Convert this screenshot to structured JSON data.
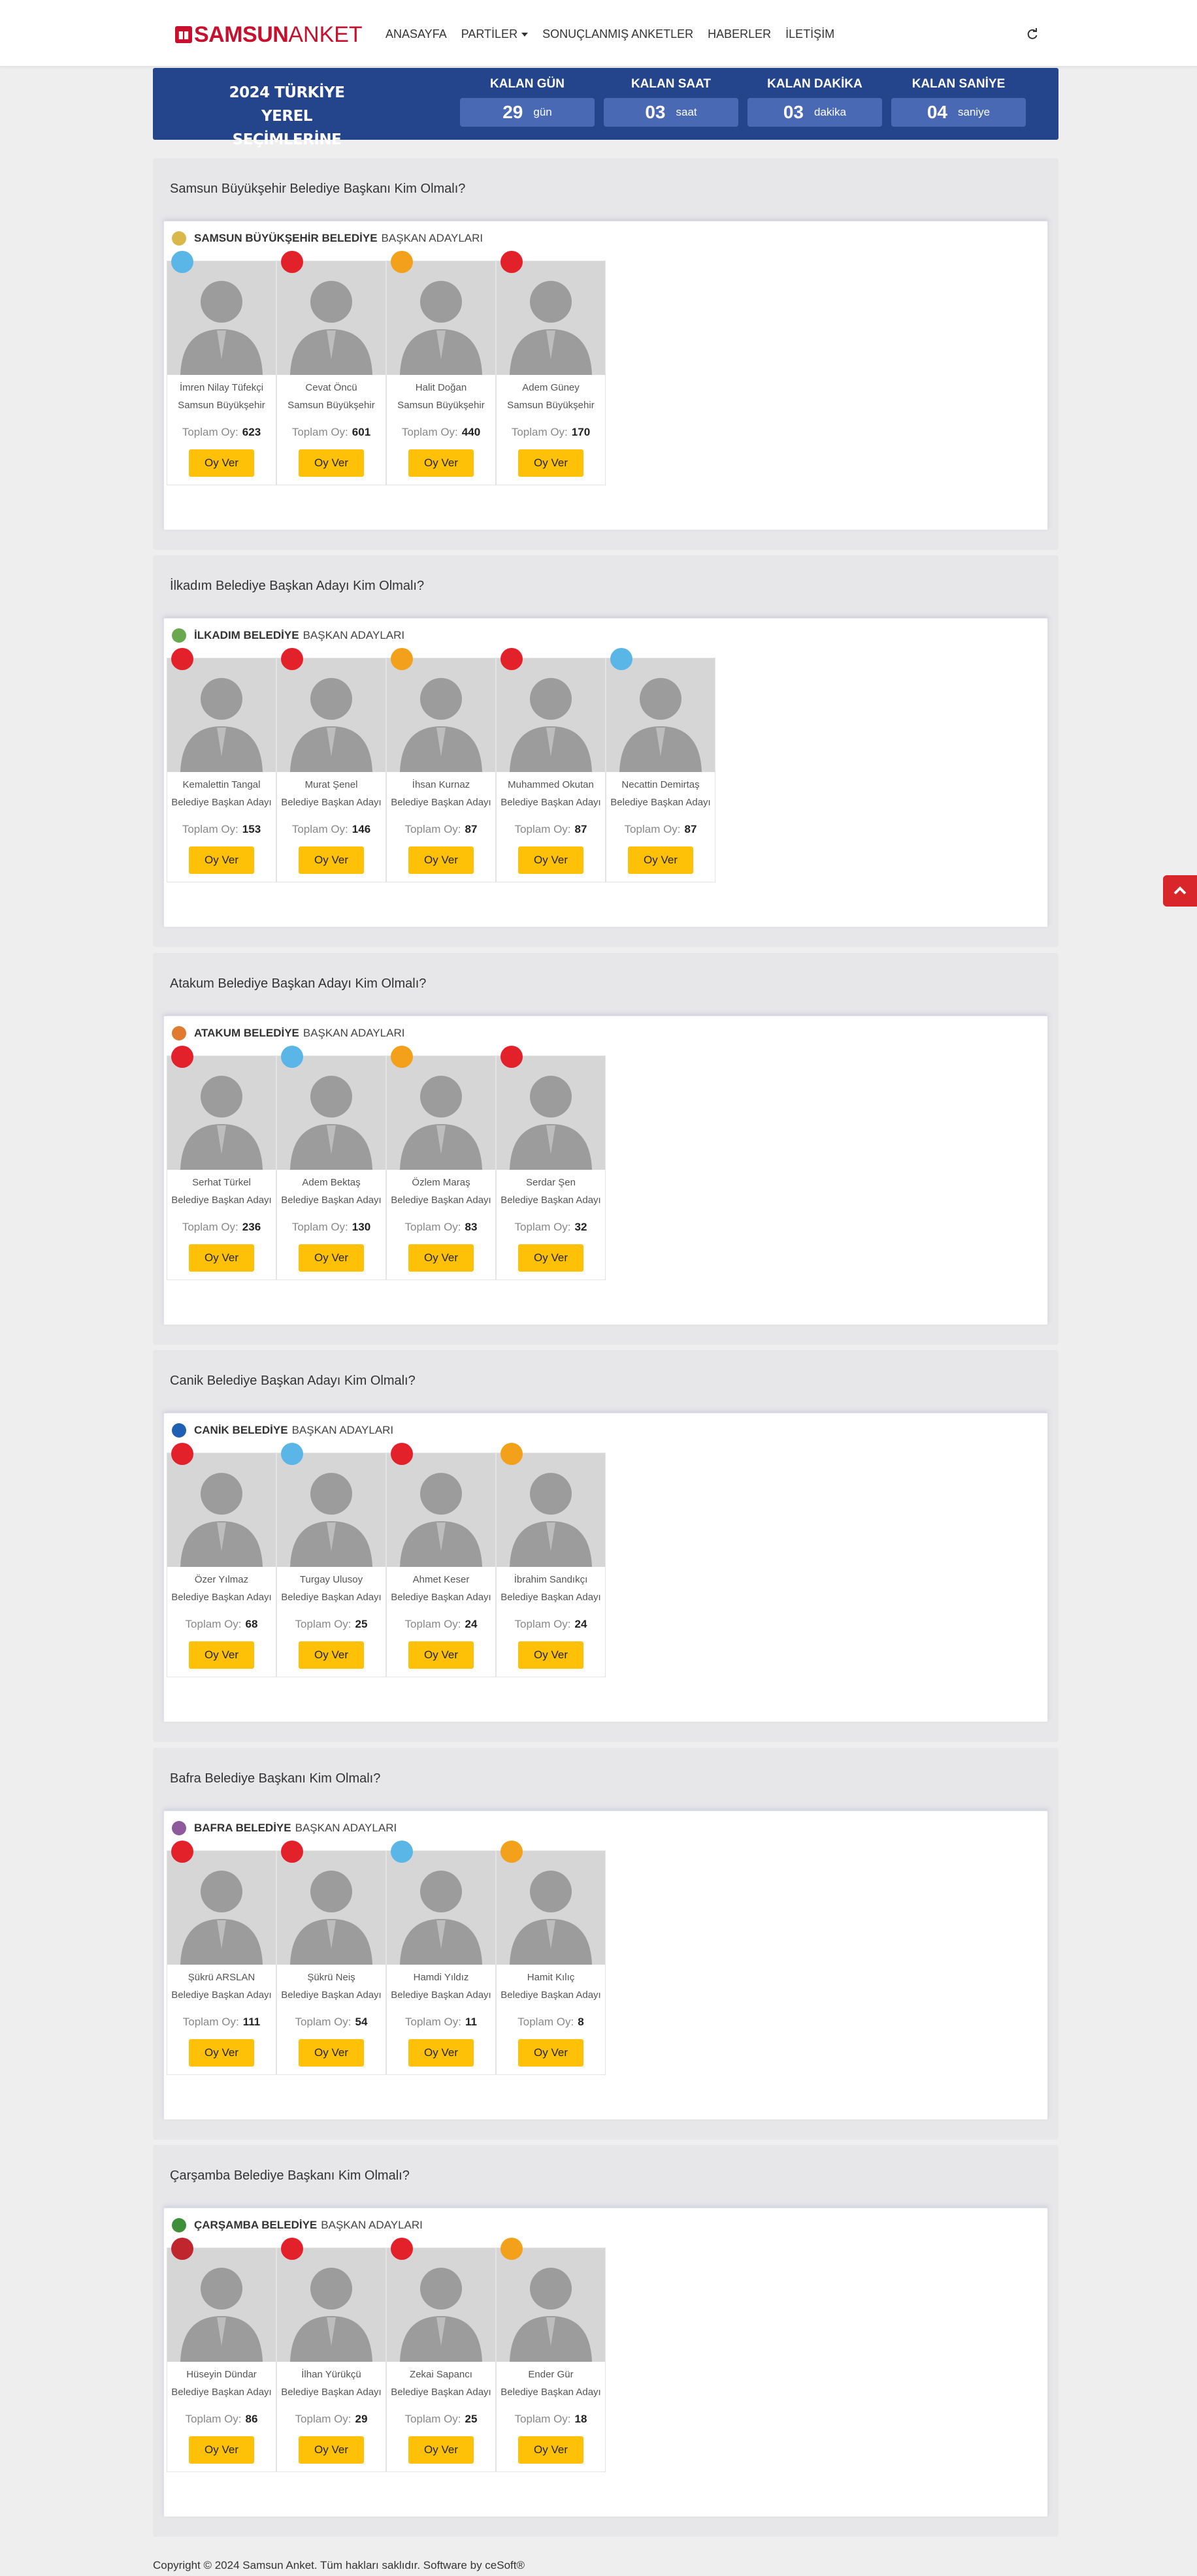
{
  "brand": {
    "part_a": "SAMSUN",
    "part_b": "ANKET"
  },
  "menu": [
    {
      "label": "ANASAYFA"
    },
    {
      "label": "PARTİLER"
    },
    {
      "label": "SONUÇLANMIŞ ANKETLER"
    },
    {
      "label": "HABERLER"
    },
    {
      "label": "İLETİŞİM"
    }
  ],
  "countdown": {
    "title_line1": "2024 TÜRKİYE",
    "title_line2": "YEREL SEÇİMLERİNE",
    "boxes": [
      {
        "label": "KALAN GÜN",
        "value": "29",
        "unit": "gün"
      },
      {
        "label": "KALAN SAAT",
        "value": "03",
        "unit": "saat"
      },
      {
        "label": "KALAN DAKİKA",
        "value": "03",
        "unit": "dakika"
      },
      {
        "label": "KALAN SANİYE",
        "value": "04",
        "unit": "saniye"
      }
    ]
  },
  "sections": [
    {
      "question": "Samsun Büyükşehir Belediye Başkanı Kim Olmalı?",
      "municipality": "SAMSUN BÜYÜKŞEHİR BELEDİYE",
      "suffix": "BAŞKAN ADAYLARI",
      "candidates": [
        {
          "name": "İmren Nilay Tüfekçi",
          "title": "Samsun Büyükşehir",
          "votes": "623",
          "button": "Oy Ver",
          "party_color": "#5ab6e6"
        },
        {
          "name": "Cevat Öncü",
          "title": "Samsun Büyükşehir",
          "votes": "601",
          "button": "Oy Ver",
          "party_color": "#e3212a"
        },
        {
          "name": "Halit Doğan",
          "title": "Samsun Büyükşehir",
          "votes": "440",
          "button": "Oy Ver",
          "party_color": "#f3a01b"
        },
        {
          "name": "Adem Güney",
          "title": "Samsun Büyükşehir",
          "votes": "170",
          "button": "Oy Ver",
          "party_color": "#e3212a"
        }
      ]
    },
    {
      "question": "İlkadım Belediye Başkan Adayı Kim Olmalı?",
      "municipality": "İLKADIM BELEDİYE",
      "suffix": "BAŞKAN ADAYLARI",
      "candidates": [
        {
          "name": "Kemalettin Tangal",
          "title": "Belediye Başkan Adayı",
          "votes": "153",
          "button": "Oy Ver",
          "party_color": "#e3212a"
        },
        {
          "name": "Murat Şenel",
          "title": "Belediye Başkan Adayı",
          "votes": "146",
          "button": "Oy Ver",
          "party_color": "#e3212a"
        },
        {
          "name": "İhsan Kurnaz",
          "title": "Belediye Başkan Adayı",
          "votes": "87",
          "button": "Oy Ver",
          "party_color": "#f3a01b"
        },
        {
          "name": "Muhammed Okutan",
          "title": "Belediye Başkan Adayı",
          "votes": "87",
          "button": "Oy Ver",
          "party_color": "#e3212a"
        },
        {
          "name": "Necattin Demirtaş",
          "title": "Belediye Başkan Adayı",
          "votes": "87",
          "button": "Oy Ver",
          "party_color": "#5ab6e6"
        }
      ]
    },
    {
      "question": "Atakum Belediye Başkan Adayı Kim Olmalı?",
      "municipality": "ATAKUM BELEDİYE",
      "suffix": "BAŞKAN ADAYLARI",
      "candidates": [
        {
          "name": "Serhat Türkel",
          "title": "Belediye Başkan Adayı",
          "votes": "236",
          "button": "Oy Ver",
          "party_color": "#e3212a"
        },
        {
          "name": "Adem Bektaş",
          "title": "Belediye Başkan Adayı",
          "votes": "130",
          "button": "Oy Ver",
          "party_color": "#5ab6e6"
        },
        {
          "name": "Özlem Maraş",
          "title": "Belediye Başkan Adayı",
          "votes": "83",
          "button": "Oy Ver",
          "party_color": "#f3a01b"
        },
        {
          "name": "Serdar Şen",
          "title": "Belediye Başkan Adayı",
          "votes": "32",
          "button": "Oy Ver",
          "party_color": "#e3212a"
        }
      ]
    },
    {
      "question": "Canik Belediye Başkan Adayı Kim Olmalı?",
      "municipality": "CANİK BELEDİYE",
      "suffix": "BAŞKAN ADAYLARI",
      "candidates": [
        {
          "name": "Özer Yılmaz",
          "title": "Belediye Başkan Adayı",
          "votes": "68",
          "button": "Oy Ver",
          "party_color": "#e3212a"
        },
        {
          "name": "Turgay Ulusoy",
          "title": "Belediye Başkan Adayı",
          "votes": "25",
          "button": "Oy Ver",
          "party_color": "#5ab6e6"
        },
        {
          "name": "Ahmet Keser",
          "title": "Belediye Başkan Adayı",
          "votes": "24",
          "button": "Oy Ver",
          "party_color": "#e3212a"
        },
        {
          "name": "İbrahim Sandıkçı",
          "title": "Belediye Başkan Adayı",
          "votes": "24",
          "button": "Oy Ver",
          "party_color": "#f3a01b"
        }
      ]
    },
    {
      "question": "Bafra Belediye Başkanı Kim Olmalı?",
      "municipality": "BAFRA BELEDİYE",
      "suffix": "BAŞKAN ADAYLARI",
      "candidates": [
        {
          "name": "Şükrü ARSLAN",
          "title": "Belediye Başkan Adayı",
          "votes": "111",
          "button": "Oy Ver",
          "party_color": "#e3212a"
        },
        {
          "name": "Şükrü Neiş",
          "title": "Belediye Başkan Adayı",
          "votes": "54",
          "button": "Oy Ver",
          "party_color": "#e3212a"
        },
        {
          "name": "Hamdi Yıldız",
          "title": "Belediye Başkan Adayı",
          "votes": "11",
          "button": "Oy Ver",
          "party_color": "#5ab6e6"
        },
        {
          "name": "Hamit Kılıç",
          "title": "Belediye Başkan Adayı",
          "votes": "8",
          "button": "Oy Ver",
          "party_color": "#f3a01b"
        }
      ]
    },
    {
      "question": "Çarşamba Belediye Başkanı Kim Olmalı?",
      "municipality": "ÇARŞAMBA BELEDİYE",
      "suffix": "BAŞKAN ADAYLARI",
      "candidates": [
        {
          "name": "Hüseyin Dündar",
          "title": "Belediye Başkan Adayı",
          "votes": "86",
          "button": "Oy Ver",
          "party_color": "#c0262d"
        },
        {
          "name": "İlhan Yürükçü",
          "title": "Belediye Başkan Adayı",
          "votes": "29",
          "button": "Oy Ver",
          "party_color": "#e3212a"
        },
        {
          "name": "Zekai Sapancı",
          "title": "Belediye Başkan Adayı",
          "votes": "25",
          "button": "Oy Ver",
          "party_color": "#e3212a"
        },
        {
          "name": "Ender Gür",
          "title": "Belediye Başkan Adayı",
          "votes": "18",
          "button": "Oy Ver",
          "party_color": "#f3a01b"
        }
      ]
    }
  ],
  "footer": {
    "text": "Copyright © 2024 Samsun Anket. Tüm hakları saklıdır. Software by ceSoft®"
  }
}
